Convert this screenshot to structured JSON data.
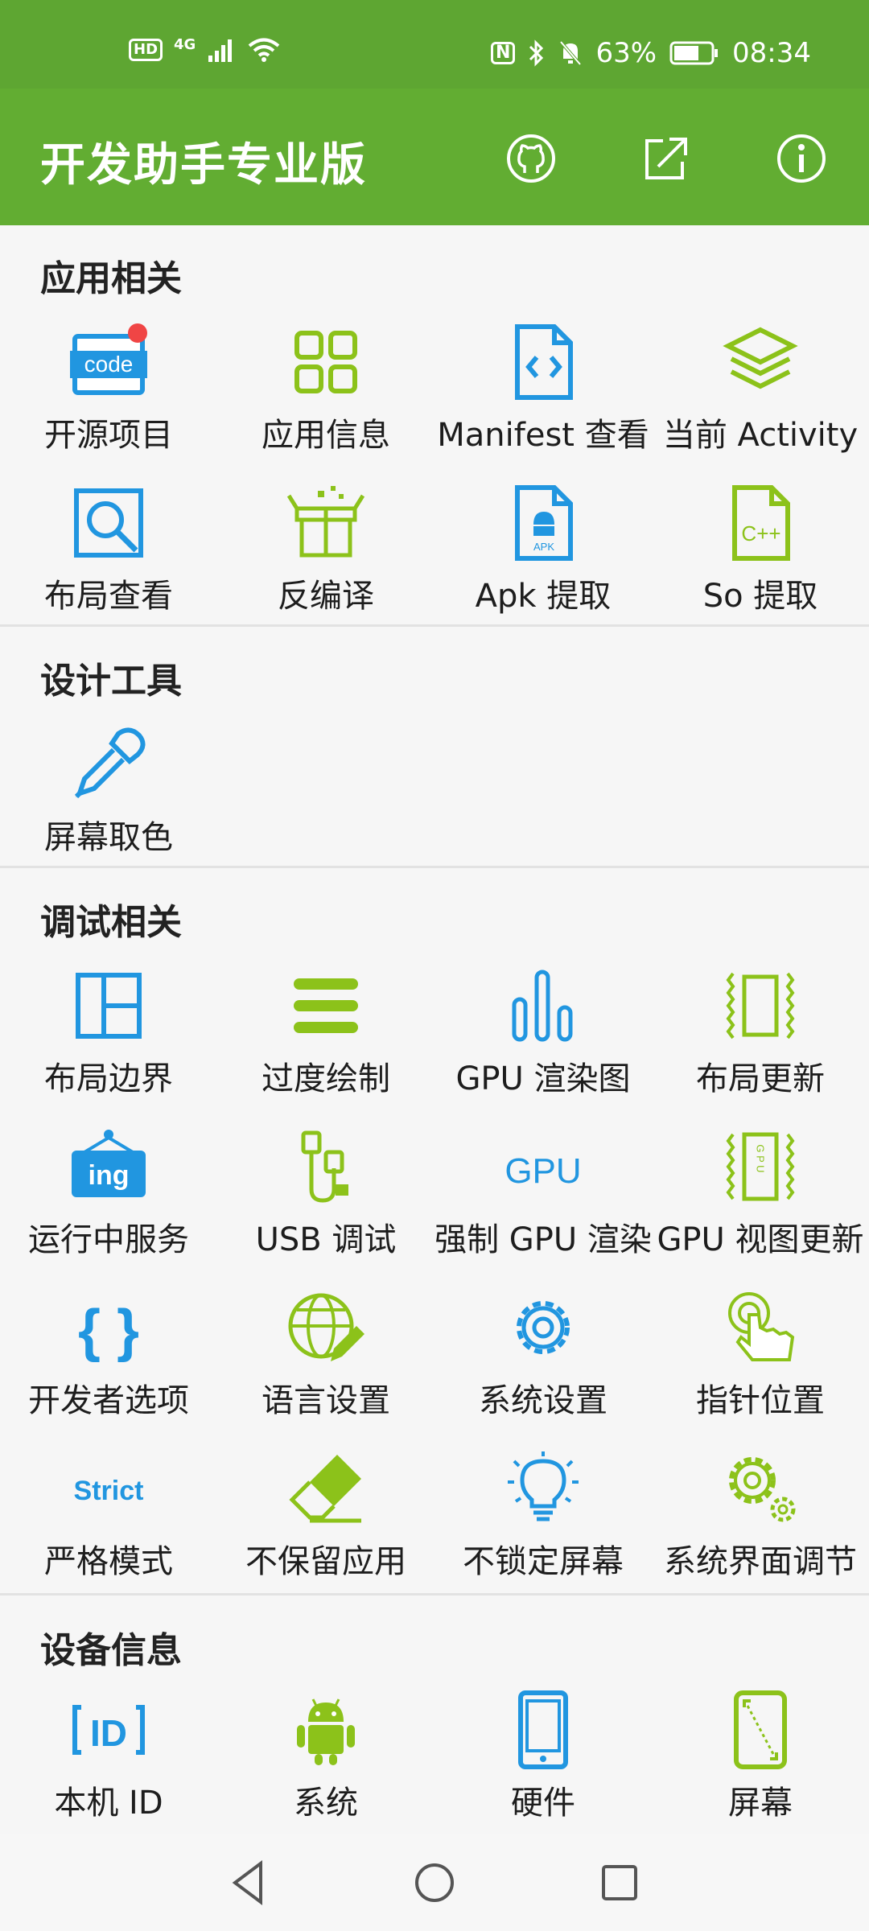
{
  "status_bar": {
    "hd_badge": "HD",
    "network": "4G",
    "battery": "63%",
    "time": "08:34",
    "nfc_badge": "N"
  },
  "app_bar": {
    "title": "开发助手专业版"
  },
  "sections": {
    "app": {
      "title": "应用相关",
      "items": [
        "开源项目",
        "应用信息",
        "Manifest 查看",
        "当前 Activity",
        "布局查看",
        "反编译",
        "Apk 提取",
        "So 提取"
      ],
      "code_text": "code",
      "apk_text": "APK",
      "cpp_text": "C++"
    },
    "design": {
      "title": "设计工具",
      "items": [
        "屏幕取色"
      ]
    },
    "debug": {
      "title": "调试相关",
      "items": [
        "布局边界",
        "过度绘制",
        "GPU 渲染图",
        "布局更新",
        "运行中服务",
        "USB 调试",
        "强制 GPU 渲染",
        "GPU 视图更新",
        "开发者选项",
        "语言设置",
        "系统设置",
        "指针位置",
        "严格模式",
        "不保留应用",
        "不锁定屏幕",
        "系统界面调节"
      ],
      "ing_text": "ing",
      "gpu_text": "GPU",
      "gpu_vertical_text": "G P U",
      "braces_text": "{ }",
      "strict_text": "Strict"
    },
    "device": {
      "title": "设备信息",
      "items": [
        "本机 ID",
        "系统",
        "硬件",
        "屏幕"
      ],
      "id_text": "ID"
    }
  },
  "colors": {
    "primary": "#62ad32",
    "status": "#5ea632",
    "blue": "#2196e0",
    "green": "#8cc21a",
    "badge": "#f04545"
  }
}
